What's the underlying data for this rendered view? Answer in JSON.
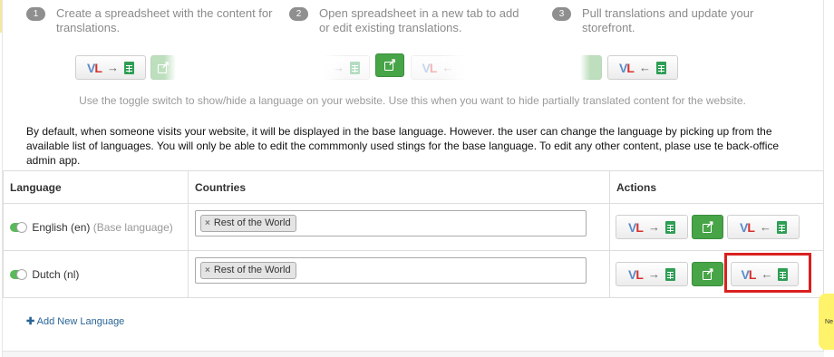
{
  "steps": [
    {
      "num": "1",
      "text": "Create a spreadsheet with the content for translations."
    },
    {
      "num": "2",
      "text": "Open spreadsheet in a new tab to add or edit existing translations."
    },
    {
      "num": "3",
      "text": "Pull translations and update your storefront."
    }
  ],
  "logo": {
    "v": "V",
    "l": "L"
  },
  "arrows": {
    "to_sheet": "→",
    "from_sheet": "←"
  },
  "toggle_note": "Use the toggle switch to show/hide a language on your website. Use this when you want to hide partially translated content for the website.",
  "description": "By default, when someone visits your website, it will be displayed in the base language. However. the user can change the language by picking up from the available list of languages. You will only be able to edit the commmonly used stings for the base language. To edit any other content, plase use te back-office admin app.",
  "table": {
    "headers": {
      "language": "Language",
      "countries": "Countries",
      "actions": "Actions"
    },
    "rows": [
      {
        "language": "English (en)",
        "note": "(Base language)",
        "country_tag": "Rest of the World",
        "enabled": true
      },
      {
        "language": "Dutch (nl)",
        "note": "",
        "country_tag": "Rest of the World",
        "enabled": true
      }
    ]
  },
  "tag_remove": "×",
  "add_language": {
    "plus": "✚",
    "label": "Add New Language"
  },
  "side_tab": "Ne",
  "colors": {
    "green": "#47a447",
    "link": "#2a6496",
    "highlight": "#d9201f",
    "side_tab": "#fff36b"
  }
}
